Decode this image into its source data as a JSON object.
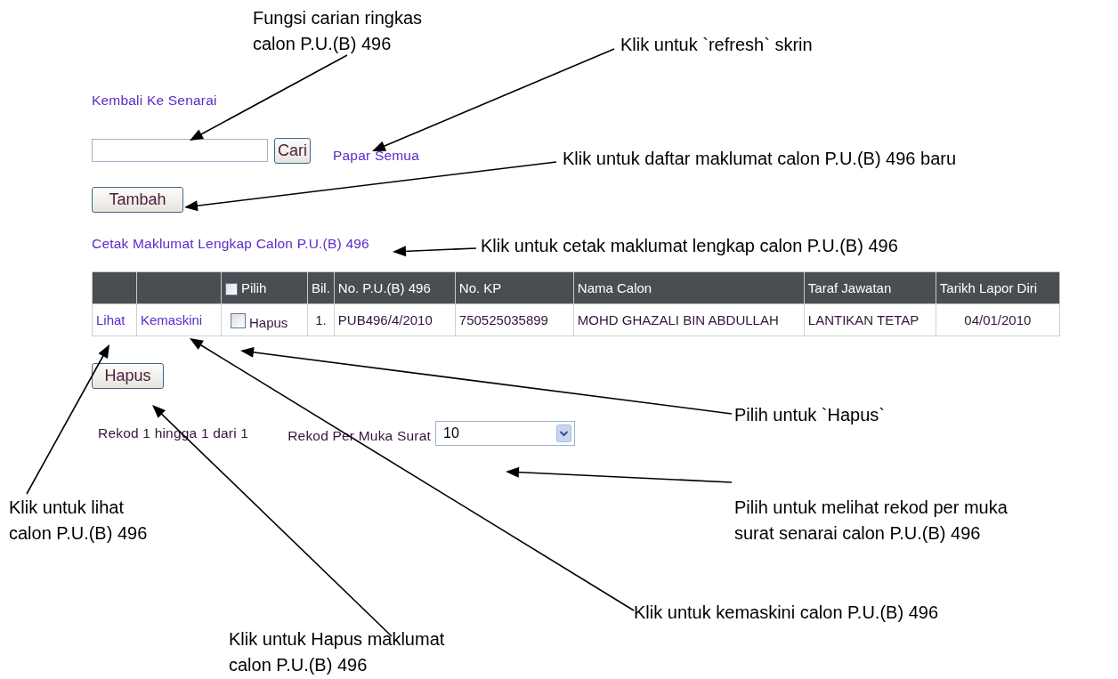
{
  "back_link": "Kembali Ke Senarai",
  "search": {
    "button": "Cari",
    "show_all": "Papar Semua"
  },
  "add_button": "Tambah",
  "print_link": "Cetak Maklumat Lengkap Calon P.U.(B) 496",
  "table": {
    "columns": [
      {
        "kind": "link"
      },
      {
        "kind": "link"
      },
      {
        "label": "Pilih",
        "kind": "checkbox",
        "checked": false
      },
      {
        "label": "Bil.",
        "kind": "text"
      },
      {
        "label": "No. P.U.(B) 496",
        "kind": "text"
      },
      {
        "label": "No. KP",
        "kind": "text"
      },
      {
        "label": "Nama Calon",
        "kind": "text"
      },
      {
        "label": "Taraf Jawatan",
        "kind": "text"
      },
      {
        "label": "Tarikh Lapor Diri",
        "kind": "text"
      }
    ],
    "rows": [
      {
        "checked": false,
        "cells": [
          "Lihat",
          "Kemaskini",
          "Hapus",
          "1.",
          "PUB496/4/2010",
          "750525035899",
          "MOHD GHAZALI BIN ABDULLAH",
          "LANTIKAN TETAP",
          "04/01/2010"
        ]
      }
    ]
  },
  "delete_button": "Hapus",
  "record_info": "Rekod 1 hingga 1 dari 1",
  "per_page": {
    "label": "Rekod Per Muka Surat",
    "value": "10"
  },
  "annotations": [
    {
      "text": "Fungsi carian ringkas\ncalon P.U.(B) 496"
    },
    {
      "text": "Klik untuk `refresh` skrin"
    },
    {
      "text": "Klik untuk daftar maklumat calon P.U.(B) 496 baru"
    },
    {
      "text": "Klik untuk cetak maklumat lengkap calon P.U.(B) 496"
    },
    {
      "text": "Pilih untuk `Hapus`"
    },
    {
      "text": "Klik untuk lihat\ncalon P.U.(B) 496"
    },
    {
      "text": "Pilih untuk melihat rekod per muka\nsurat senarai calon P.U.(B) 496"
    },
    {
      "text": "Klik untuk kemaskini calon P.U.(B) 496"
    },
    {
      "text": "Klik untuk Hapus maklumat\ncalon P.U.(B) 496"
    }
  ]
}
